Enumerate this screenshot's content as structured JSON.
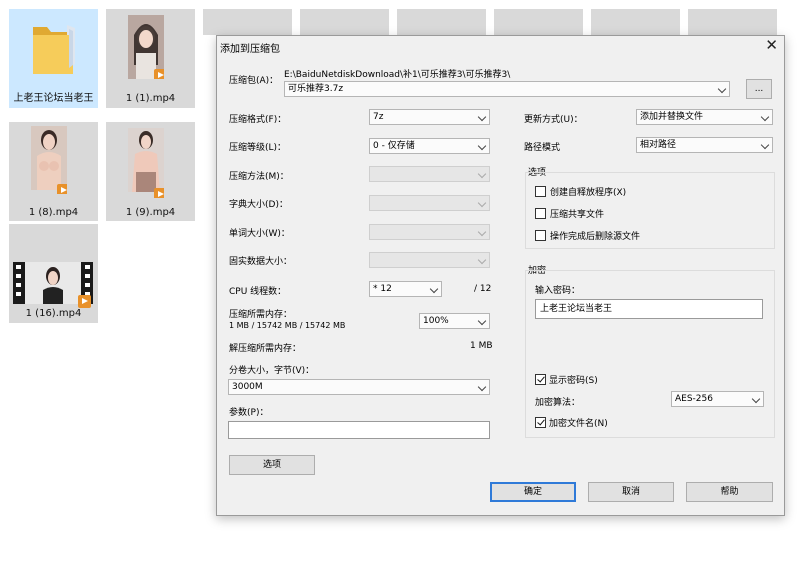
{
  "explorer": {
    "files": [
      {
        "name": "上老王论坛当老王",
        "type": "folder"
      },
      {
        "name": "1 (1).mp4",
        "type": "video"
      },
      {
        "name": "1 (8).mp4",
        "type": "video"
      },
      {
        "name": "1 (9).mp4",
        "type": "video"
      },
      {
        "name": "1 (16).mp4",
        "type": "video"
      }
    ]
  },
  "dialog": {
    "title": "添加到压缩包",
    "close_glyph": "✕",
    "archive_label": "压缩包(A)：",
    "archive_path": "E:\\BaiduNetdiskDownload\\补1\\可乐推荐3\\可乐推荐3\\",
    "archive_name": "可乐推荐3.7z",
    "browse_label": "...",
    "format_label": "压缩格式(F)：",
    "format_value": "7z",
    "level_label": "压缩等级(L)：",
    "level_value": "0 - 仅存储",
    "method_label": "压缩方法(M)：",
    "dict_label": "字典大小(D)：",
    "word_label": "单词大小(W)：",
    "solid_label": "固实数据大小：",
    "cpu_label": "CPU 线程数：",
    "cpu_value": "* 12",
    "cpu_total": "/ 12",
    "mem_label": "压缩所需内存：",
    "mem_detail": "1 MB / 15742 MB / 15742 MB",
    "mem_percent": "100%",
    "demem_label": "解压缩所需内存：",
    "demem_value": "1 MB",
    "volume_label": "分卷大小，字节(V)：",
    "volume_value": "3000M",
    "params_label": "参数(P)：",
    "params_value": "",
    "options_button": "选项",
    "update_label": "更新方式(U)：",
    "update_value": "添加并替换文件",
    "path_label": "路径模式",
    "path_value": "相对路径",
    "options_group": "选项",
    "opt_sfx": "创建自释放程序(X)",
    "opt_shared": "压缩共享文件",
    "opt_delete": "操作完成后删除源文件",
    "encrypt_group": "加密",
    "password_label": "输入密码：",
    "password_value": "上老王论坛当老王",
    "show_password": "显示密码(S)",
    "algo_label": "加密算法：",
    "algo_value": "AES-256",
    "encrypt_names": "加密文件名(N)",
    "ok": "确定",
    "cancel": "取消",
    "help": "帮助"
  }
}
